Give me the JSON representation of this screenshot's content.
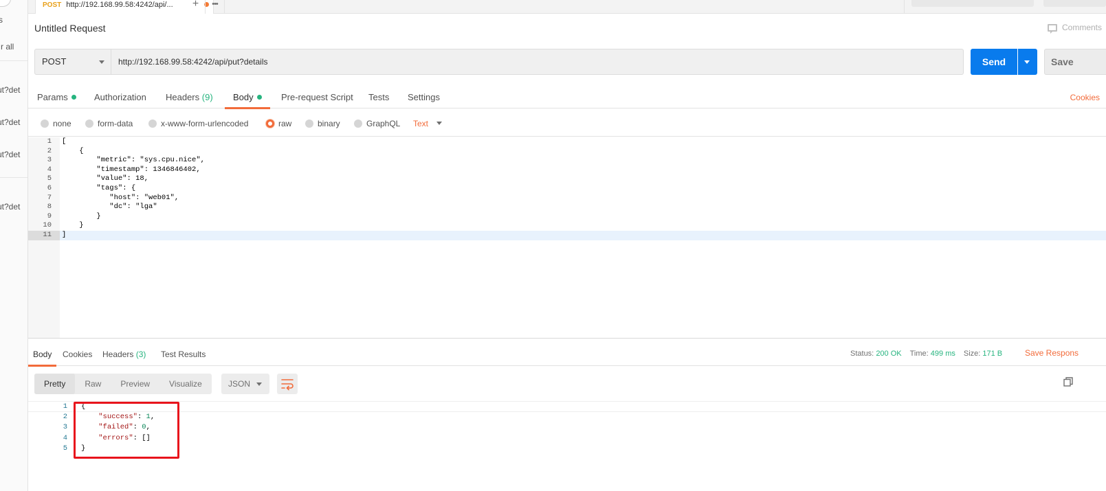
{
  "sidebar": {
    "partials": [
      "s",
      "r all",
      "ut?det",
      "ut?det",
      "ut?det",
      "ut?det"
    ]
  },
  "tab_bar": {
    "tab_method": "POST",
    "tab_url": "http://192.168.99.58:4242/api/...",
    "new_tab_label": "+",
    "more_label": "•••"
  },
  "request": {
    "title": "Untitled Request",
    "comments_label": "Comments",
    "method": "POST",
    "url": "http://192.168.99.58:4242/api/put?details",
    "send_label": "Send",
    "save_label": "Save"
  },
  "request_tabs": {
    "params": "Params",
    "authorization": "Authorization",
    "headers": "Headers",
    "headers_count": "(9)",
    "body": "Body",
    "pre_request": "Pre-request Script",
    "tests": "Tests",
    "settings": "Settings",
    "cookies": "Cookies"
  },
  "body_types": {
    "options": [
      "none",
      "form-data",
      "x-www-form-urlencoded",
      "raw",
      "binary",
      "GraphQL"
    ],
    "selected": "raw",
    "format": "Text"
  },
  "editor": {
    "lines": [
      "[",
      "    {",
      "        \"metric\": \"sys.cpu.nice\",",
      "        \"timestamp\": 1346846402,",
      "        \"value\": 18,",
      "        \"tags\": {",
      "           \"host\": \"web01\",",
      "           \"dc\": \"lga\"",
      "        }",
      "    }",
      "]"
    ],
    "line_numbers": [
      "1",
      "2",
      "3",
      "4",
      "5",
      "6",
      "7",
      "8",
      "9",
      "10",
      "11"
    ]
  },
  "response_tabs": {
    "body": "Body",
    "cookies": "Cookies",
    "headers": "Headers",
    "headers_count": "(3)",
    "test_results": "Test Results"
  },
  "response_meta": {
    "status_label": "Status:",
    "status_value": "200 OK",
    "time_label": "Time:",
    "time_value": "499 ms",
    "size_label": "Size:",
    "size_value": "171 B",
    "save_response": "Save Respons"
  },
  "response_view": {
    "modes": [
      "Pretty",
      "Raw",
      "Preview",
      "Visualize"
    ],
    "active_mode": "Pretty",
    "format": "JSON"
  },
  "response_body": {
    "line_numbers": [
      "1",
      "2",
      "3",
      "4",
      "5"
    ],
    "lines": [
      {
        "open": "{"
      },
      {
        "key": "\"success\"",
        "value": "1",
        "tail": ","
      },
      {
        "key": "\"failed\"",
        "value": "0",
        "tail": ","
      },
      {
        "key": "\"errors\"",
        "value": "[]",
        "tail": ""
      },
      {
        "open": "}"
      }
    ]
  },
  "colors": {
    "accent": "#f26b3a",
    "send_blue": "#097bed",
    "status_green": "#26b47f",
    "highlight_red": "#e8141c"
  }
}
